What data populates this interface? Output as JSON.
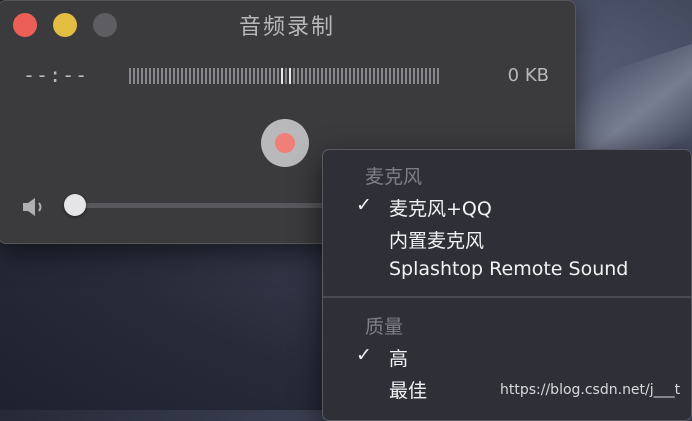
{
  "window": {
    "title": "音频录制",
    "elapsed_time": "--:--",
    "file_size": "0 KB",
    "volume_level": 0.0
  },
  "menu": {
    "sections": [
      {
        "header": "麦克风",
        "items": [
          {
            "label": "麦克风+QQ",
            "checked": true
          },
          {
            "label": "内置麦克风",
            "checked": false
          },
          {
            "label": "Splashtop Remote Sound",
            "checked": false
          }
        ]
      },
      {
        "header": "质量",
        "items": [
          {
            "label": "高",
            "checked": true
          },
          {
            "label": "最佳",
            "checked": false
          }
        ]
      }
    ],
    "check_glyph": "✓"
  },
  "watermark": "https://blog.csdn.net/j___t",
  "colors": {
    "close": "#ec5f57",
    "minimize": "#e3bd42",
    "record": "#f07f78"
  },
  "icons": {
    "volume": "speaker-icon",
    "record": "record-icon"
  }
}
